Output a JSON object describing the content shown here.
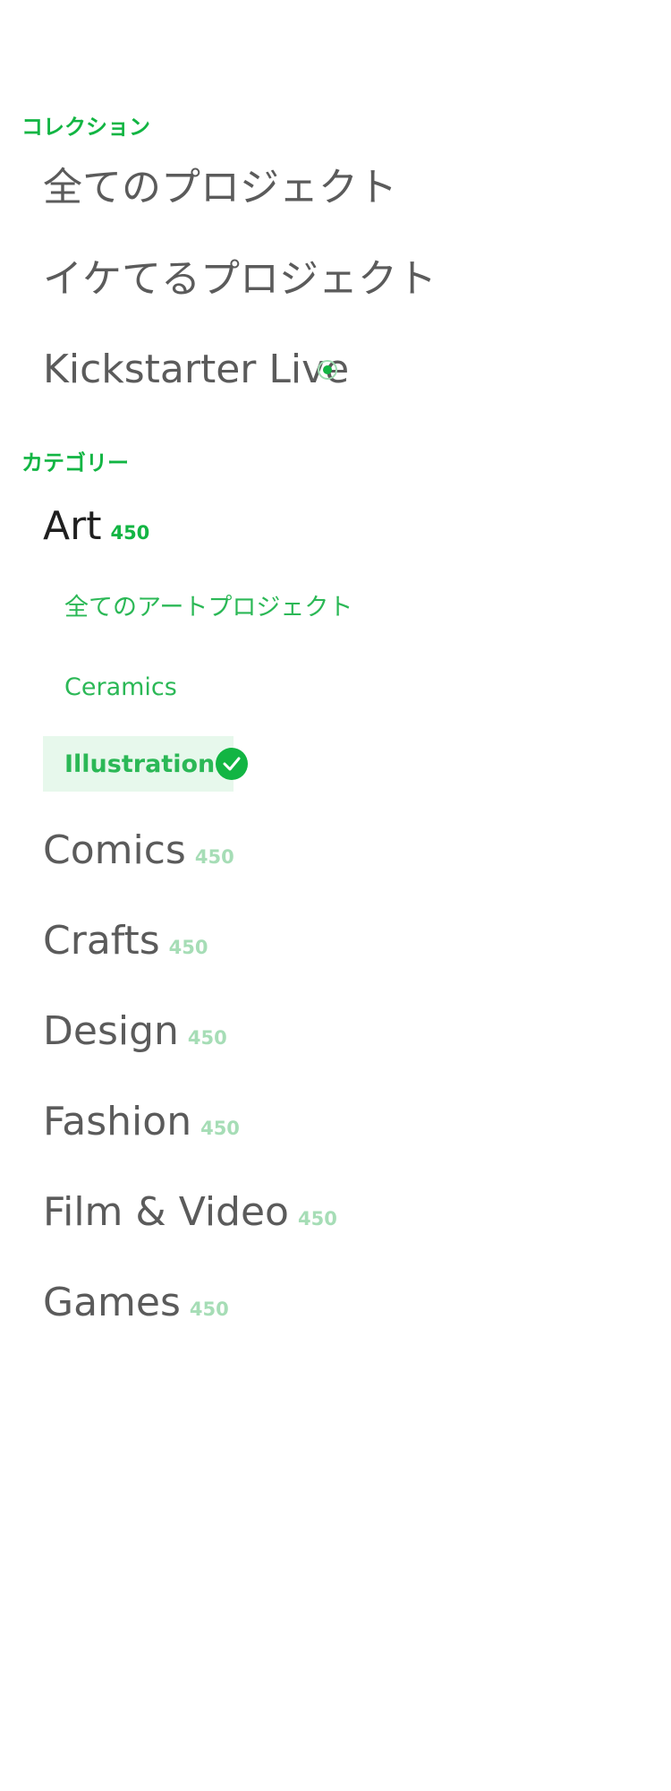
{
  "collections": {
    "header": "コレクション",
    "items": [
      {
        "label": "全てのプロジェクト"
      },
      {
        "label": "イケてるプロジェクト"
      },
      {
        "label": "Kickstarter Live",
        "icon": "live-indicator-icon"
      }
    ]
  },
  "categories": {
    "header": "カテゴリー",
    "selected": {
      "label": "Art",
      "count": "450",
      "subcategories": [
        {
          "label": "全てのアートプロジェクト"
        },
        {
          "label": "Ceramics"
        },
        {
          "label": "Illustration",
          "selected": true,
          "icon": "checkmark-icon"
        }
      ]
    },
    "items": [
      {
        "label": "Comics",
        "count": "450"
      },
      {
        "label": "Crafts",
        "count": "450"
      },
      {
        "label": "Design",
        "count": "450"
      },
      {
        "label": "Fashion",
        "count": "450"
      },
      {
        "label": "Film & Video",
        "count": "450"
      },
      {
        "label": "Games",
        "count": "450"
      }
    ]
  },
  "colors": {
    "accent": "#12b543",
    "count_muted": "#a6ddb6",
    "highlight_bg": "#e7f8ec",
    "text": "#5b5b5b"
  }
}
